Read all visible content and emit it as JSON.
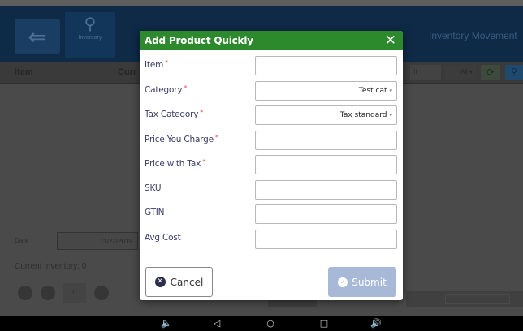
{
  "background": {
    "header": {
      "back_icon": "back-arrow-icon",
      "inventory_label": "Inventory",
      "inventory_icon": "search-icon",
      "inventory_movement": "Inventory Movement"
    },
    "subbar": {
      "col_item": "Item",
      "col_current": "Curr",
      "filter_value": "All",
      "sync_icon": "sync-icon",
      "search_icon": "search-icon"
    },
    "date_label": "Date",
    "date_value": "11/22/2019",
    "current_inventory": "Current Inventory: 0",
    "qty_value": "0"
  },
  "modal": {
    "title": "Add Product Quickly",
    "close_icon": "close-icon",
    "fields": [
      {
        "label": "Item",
        "required": true,
        "type": "text",
        "value": ""
      },
      {
        "label": "Category",
        "required": true,
        "type": "select",
        "value": "Test cat"
      },
      {
        "label": "Tax Category",
        "required": true,
        "type": "select",
        "value": "Tax standard"
      },
      {
        "label": "Price You Charge",
        "required": true,
        "type": "text",
        "value": ""
      },
      {
        "label": "Price with Tax",
        "required": true,
        "type": "text",
        "value": ""
      },
      {
        "label": "SKU",
        "required": false,
        "type": "text",
        "value": ""
      },
      {
        "label": "GTIN",
        "required": false,
        "type": "text",
        "value": ""
      },
      {
        "label": "Avg Cost",
        "required": false,
        "type": "text",
        "value": ""
      }
    ],
    "required_marker": "*",
    "cancel_label": "Cancel",
    "submit_label": "Submit"
  },
  "navbar": {
    "icons": [
      "volume-down-icon",
      "back-icon",
      "home-icon",
      "recents-icon",
      "volume-up-icon"
    ]
  },
  "colors": {
    "header_green": "#2c8a2d",
    "submit_disabled": "#a7b9d6",
    "required_red": "#e05252",
    "label_text": "#3c3c66"
  }
}
